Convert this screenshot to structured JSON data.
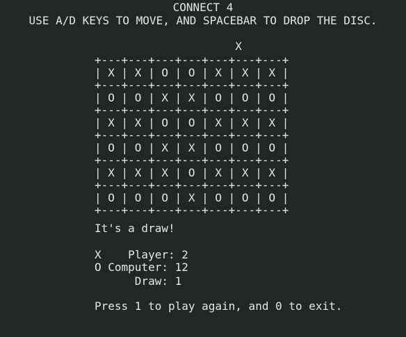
{
  "header": {
    "title": "CONNECT 4",
    "instructions": "USE A/D KEYS TO MOVE, AND SPACEBAR TO DROP THE DISC."
  },
  "board": {
    "cursor_line": "                     X",
    "separator": "+---+---+---+---+---+---+---+",
    "rows": [
      "| X | X | O | O | X | X | X |",
      "| O | O | X | X | O | O | O |",
      "| X | X | O | O | X | X | X |",
      "| O | O | X | X | O | O | O |",
      "| X | X | X | O | X | X | X |",
      "| O | O | O | X | O | O | O |"
    ]
  },
  "status": {
    "result": "It's a draw!"
  },
  "scores": {
    "player": "X    Player: 2",
    "computer": "O Computer: 12",
    "draw": "      Draw: 1"
  },
  "prompt": {
    "text": "Press 1 to play again, and 0 to exit."
  }
}
